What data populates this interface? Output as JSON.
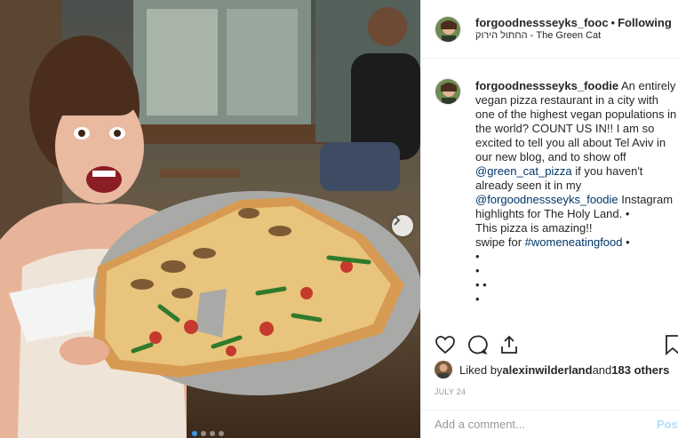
{
  "post": {
    "username": "forgoodnessseyks_foodie",
    "header_username": "forgoodnessseyks_fooc",
    "follow_label": "Following",
    "separator": "•",
    "location": "החתול הירוק - The Green Cat"
  },
  "caption": {
    "username": "forgoodnessseyks_foodie",
    "text_1": " An entirely vegan pizza restaurant in a city with one of the highest vegan populations in the world? COUNT US IN!! I am so excited to tell you all about Tel Aviv in our new blog, and to show off ",
    "mention_1": "@green_cat_pizza",
    "text_2": " if you haven't already seen it in my ",
    "mention_2": "@forgoodnessseyks_foodie",
    "text_3": " Instagram highlights for The Holy Land. •",
    "line_pizza": "This pizza is amazing!!",
    "line_swipe_prefix": "swipe for ",
    "hashtag": "#womeneatingfood",
    "line_swipe_suffix": " •",
    "dot_1": "•",
    "dot_2": "•",
    "dot_3": "• •",
    "dot_4": "•"
  },
  "likes": {
    "prefix": "Liked by ",
    "user": "alexinwilderland",
    "mid": " and ",
    "count": "183 others"
  },
  "date": "JULY 24",
  "comment": {
    "placeholder": "Add a comment...",
    "post_label": "Post"
  },
  "icons": {
    "like": "heart-icon",
    "comment": "comment-icon",
    "share": "share-icon",
    "save": "bookmark-icon",
    "next": "chevron-right-icon"
  },
  "colors": {
    "link": "#003569",
    "post_disabled": "#b2dffc",
    "carousel_active": "#3897f0"
  },
  "carousel": {
    "total": 4,
    "active": 1
  }
}
